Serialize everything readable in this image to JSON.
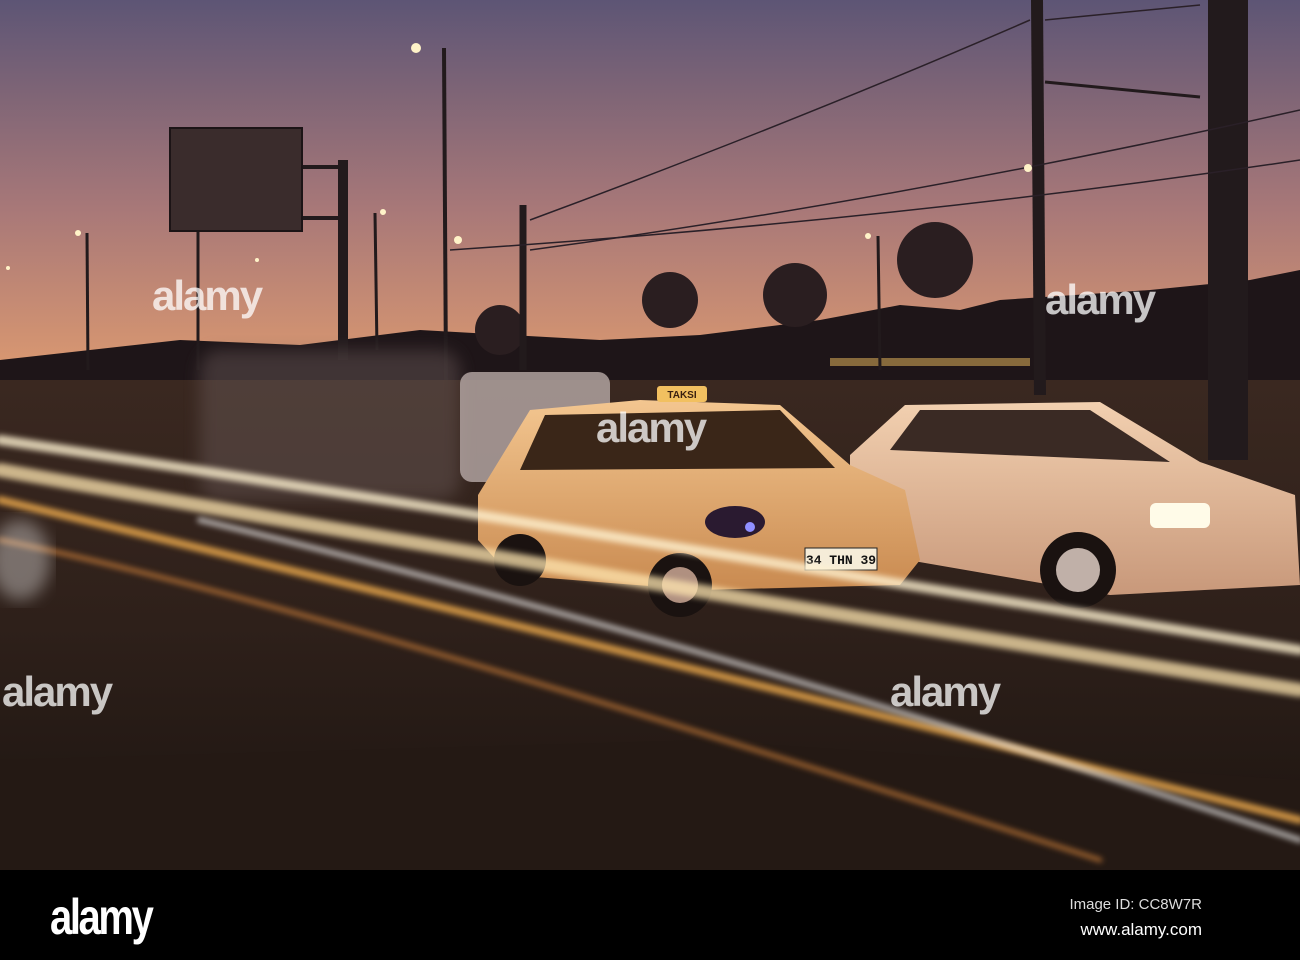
{
  "photo": {
    "taxi_roof_sign": "TAKSI",
    "taxi_plate": "34 THN 39",
    "colors": {
      "sky_top": "#5d5575",
      "sky_horizon": "#d9936e",
      "road": "#2b1d17",
      "taxi": "#e8b27a",
      "streak": "#fff2d0"
    }
  },
  "watermark": {
    "text": "alamy"
  },
  "footer": {
    "logo": "alamy",
    "image_id": "Image ID: CC8W7R",
    "url": "www.alamy.com"
  }
}
